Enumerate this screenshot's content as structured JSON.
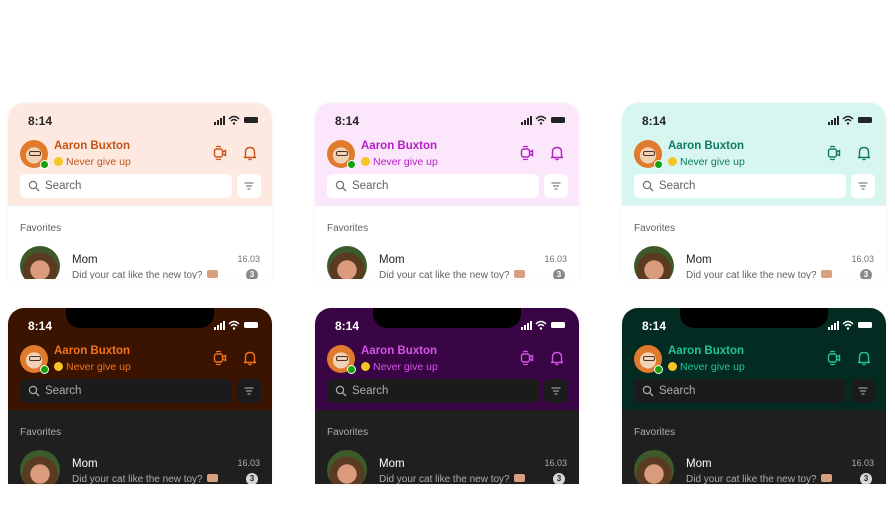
{
  "common": {
    "time": "8:14",
    "user_name": "Aaron Buxton",
    "status_message": "Never give up",
    "search_placeholder": "Search",
    "section_label": "Favorites",
    "chat": {
      "name": "Mom",
      "message": "Did your cat like the new toy?",
      "time": "16.03",
      "unread": "3"
    }
  },
  "icons": [
    "signal-icon",
    "wifi-icon",
    "battery-icon",
    "video-call-icon",
    "bell-icon",
    "search-icon",
    "filter-icon"
  ],
  "themes": [
    {
      "name": "orange-light",
      "mode": "light",
      "header_bg": "#fde9df",
      "accent": "#c4541a"
    },
    {
      "name": "magenta-light",
      "mode": "light",
      "header_bg": "#fbe6fb",
      "accent": "#b41fc4"
    },
    {
      "name": "teal-light",
      "mode": "light",
      "header_bg": "#d7f6ef",
      "accent": "#0e7a66"
    },
    {
      "name": "orange-dark",
      "mode": "dark",
      "header_bg": "#3a1400",
      "accent": "#f2741f"
    },
    {
      "name": "magenta-dark",
      "mode": "dark",
      "header_bg": "#3a0545",
      "accent": "#d355e6"
    },
    {
      "name": "teal-dark",
      "mode": "dark",
      "header_bg": "#032b22",
      "accent": "#23c49a"
    }
  ]
}
